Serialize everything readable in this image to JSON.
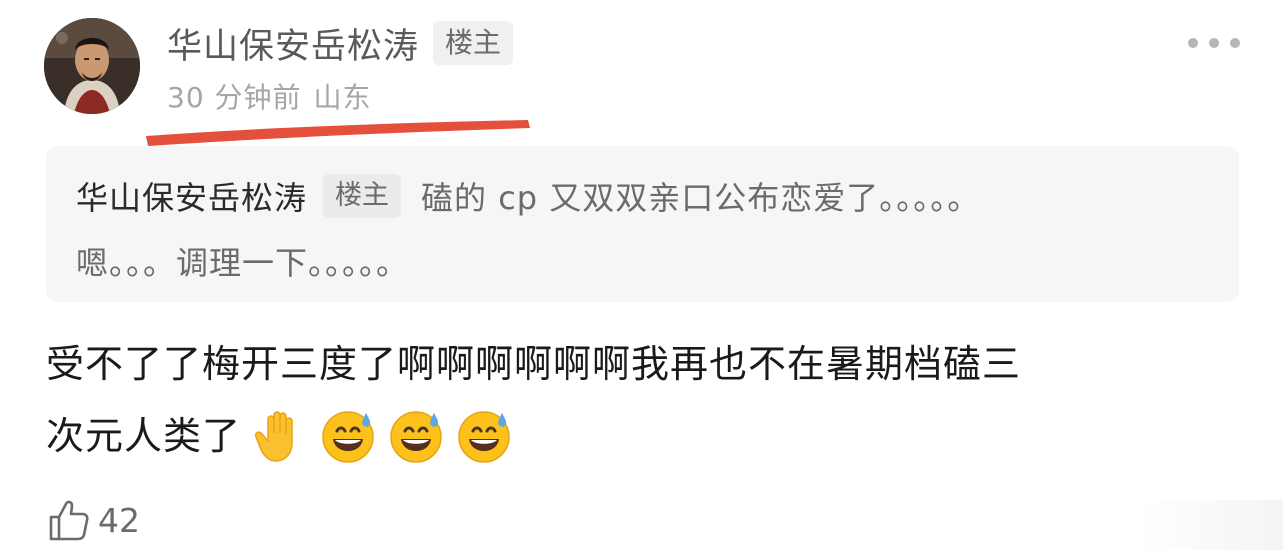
{
  "post": {
    "author": "华山保安岳松涛",
    "author_badge": "楼主",
    "time_ago": "30 分钟前",
    "location": "山东"
  },
  "quote": {
    "author": "华山保安岳松涛",
    "badge": "楼主",
    "line1": "磕的 cp 又双双亲口公布恋爱了。。。。。",
    "line2": "嗯。。。调理一下。。。。。"
  },
  "comment": {
    "line1": "受不了了梅开三度了啊啊啊啊啊啊我再也不在暑期档磕三",
    "line2": "次元人类了",
    "emojis": [
      "raised-hand-emoji",
      "grinning-sweat-emoji",
      "grinning-sweat-emoji",
      "grinning-sweat-emoji"
    ]
  },
  "actions": {
    "like_count": "42"
  },
  "colors": {
    "underline": "#e2412b",
    "name": "#5a5a5a",
    "meta": "#a6a6a6",
    "quote_bg": "#f6f6f6"
  }
}
